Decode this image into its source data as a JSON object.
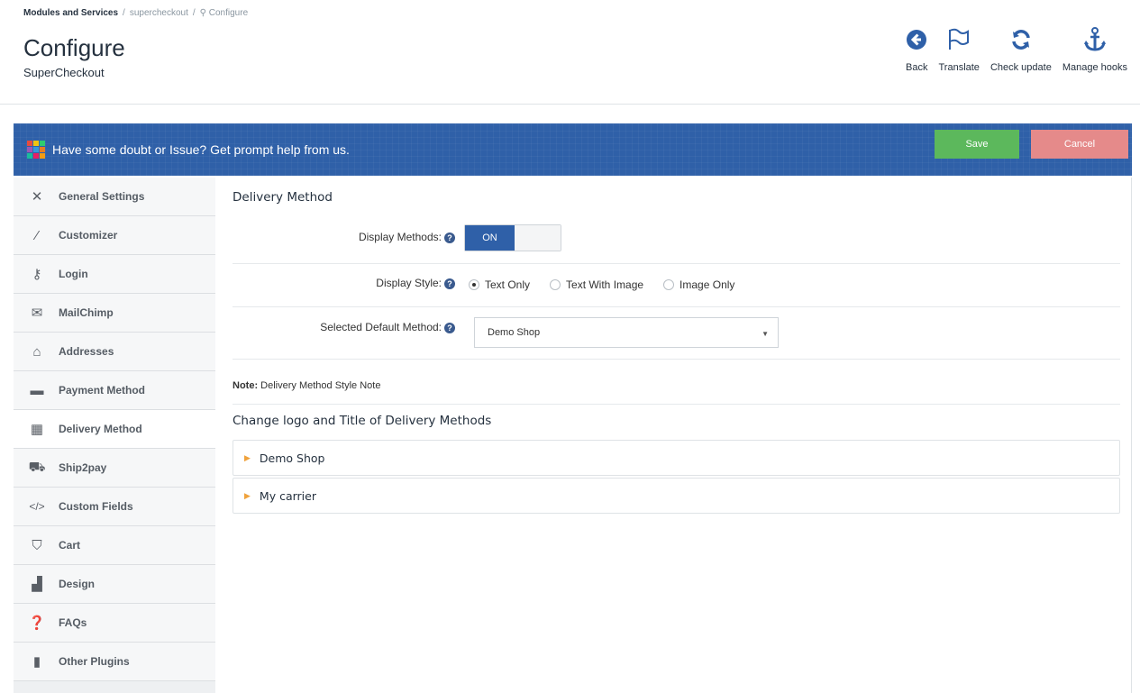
{
  "breadcrumb": {
    "root": "Modules and Services",
    "module": "supercheckout",
    "current": "Configure"
  },
  "page": {
    "title": "Configure",
    "subtitle": "SuperCheckout"
  },
  "toolbar": {
    "back": "Back",
    "translate": "Translate",
    "check_update": "Check update",
    "manage_hooks": "Manage hooks",
    "icon_color": "#2f60a8"
  },
  "banner": {
    "text": "Have some doubt or Issue? Get prompt help from us.",
    "save_label": "Save",
    "cancel_label": "Cancel",
    "background": "#2f60a8"
  },
  "sidebar": {
    "items": [
      {
        "label": "General Settings",
        "icon": "tools-icon"
      },
      {
        "label": "Customizer",
        "icon": "brush-icon"
      },
      {
        "label": "Login",
        "icon": "keys-icon"
      },
      {
        "label": "MailChimp",
        "icon": "envelope-icon"
      },
      {
        "label": "Addresses",
        "icon": "home-icon"
      },
      {
        "label": "Payment Method",
        "icon": "credit-card-icon"
      },
      {
        "label": "Delivery Method",
        "icon": "building-icon",
        "active": true
      },
      {
        "label": "Ship2pay",
        "icon": "car-icon"
      },
      {
        "label": "Custom Fields",
        "icon": "code-icon"
      },
      {
        "label": "Cart",
        "icon": "cart-icon"
      },
      {
        "label": "Design",
        "icon": "design-icon"
      },
      {
        "label": "FAQs",
        "icon": "question-icon"
      },
      {
        "label": "Other Plugins",
        "icon": "bookmark-icon"
      }
    ]
  },
  "main": {
    "section_title": "Delivery Method",
    "display_methods_label": "Display Methods:",
    "switch_on_label": "ON",
    "display_style_label": "Display Style:",
    "style_options": [
      "Text Only",
      "Text With Image",
      "Image Only"
    ],
    "style_selected": "Text Only",
    "default_method_label": "Selected Default Method:",
    "default_method_value": "Demo Shop",
    "note_label": "Note:",
    "note_text": "Delivery Method Style Note",
    "change_logo_title": "Change logo and Title of Delivery Methods",
    "carriers": [
      "Demo Shop",
      "My carrier"
    ]
  }
}
